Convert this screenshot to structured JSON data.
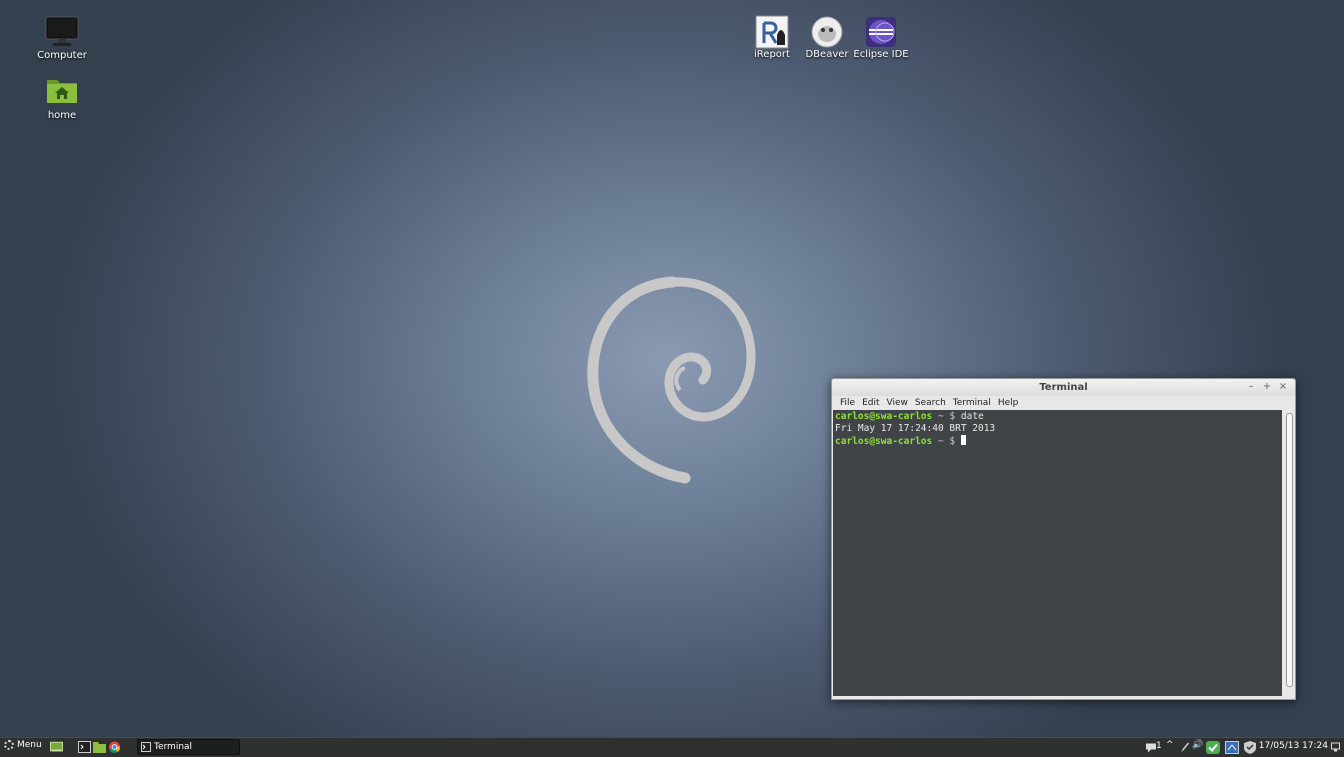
{
  "desktop": {
    "icons": [
      {
        "label": "Computer"
      },
      {
        "label": "home"
      },
      {
        "label": "iReport"
      },
      {
        "label": "DBeaver"
      },
      {
        "label": "Eclipse IDE"
      }
    ]
  },
  "terminal": {
    "title": "Terminal",
    "menu": [
      "File",
      "Edit",
      "View",
      "Search",
      "Terminal",
      "Help"
    ],
    "lines": [
      {
        "prompt": "carlos@swa-carlos",
        "path": "~ $",
        "command": "date"
      },
      {
        "output": "Fri May 17 17:24:40 BRT 2013"
      },
      {
        "prompt": "carlos@swa-carlos",
        "path": "~ $",
        "command": ""
      }
    ]
  },
  "panel": {
    "menu_label": "Menu",
    "task_label": "Terminal",
    "notification_count": "1",
    "clock": "17/05/13 17:24"
  },
  "colors": {
    "prompt_green": "#8ae234",
    "terminal_bg": "#414447",
    "panel_bg": "#2f3030"
  }
}
